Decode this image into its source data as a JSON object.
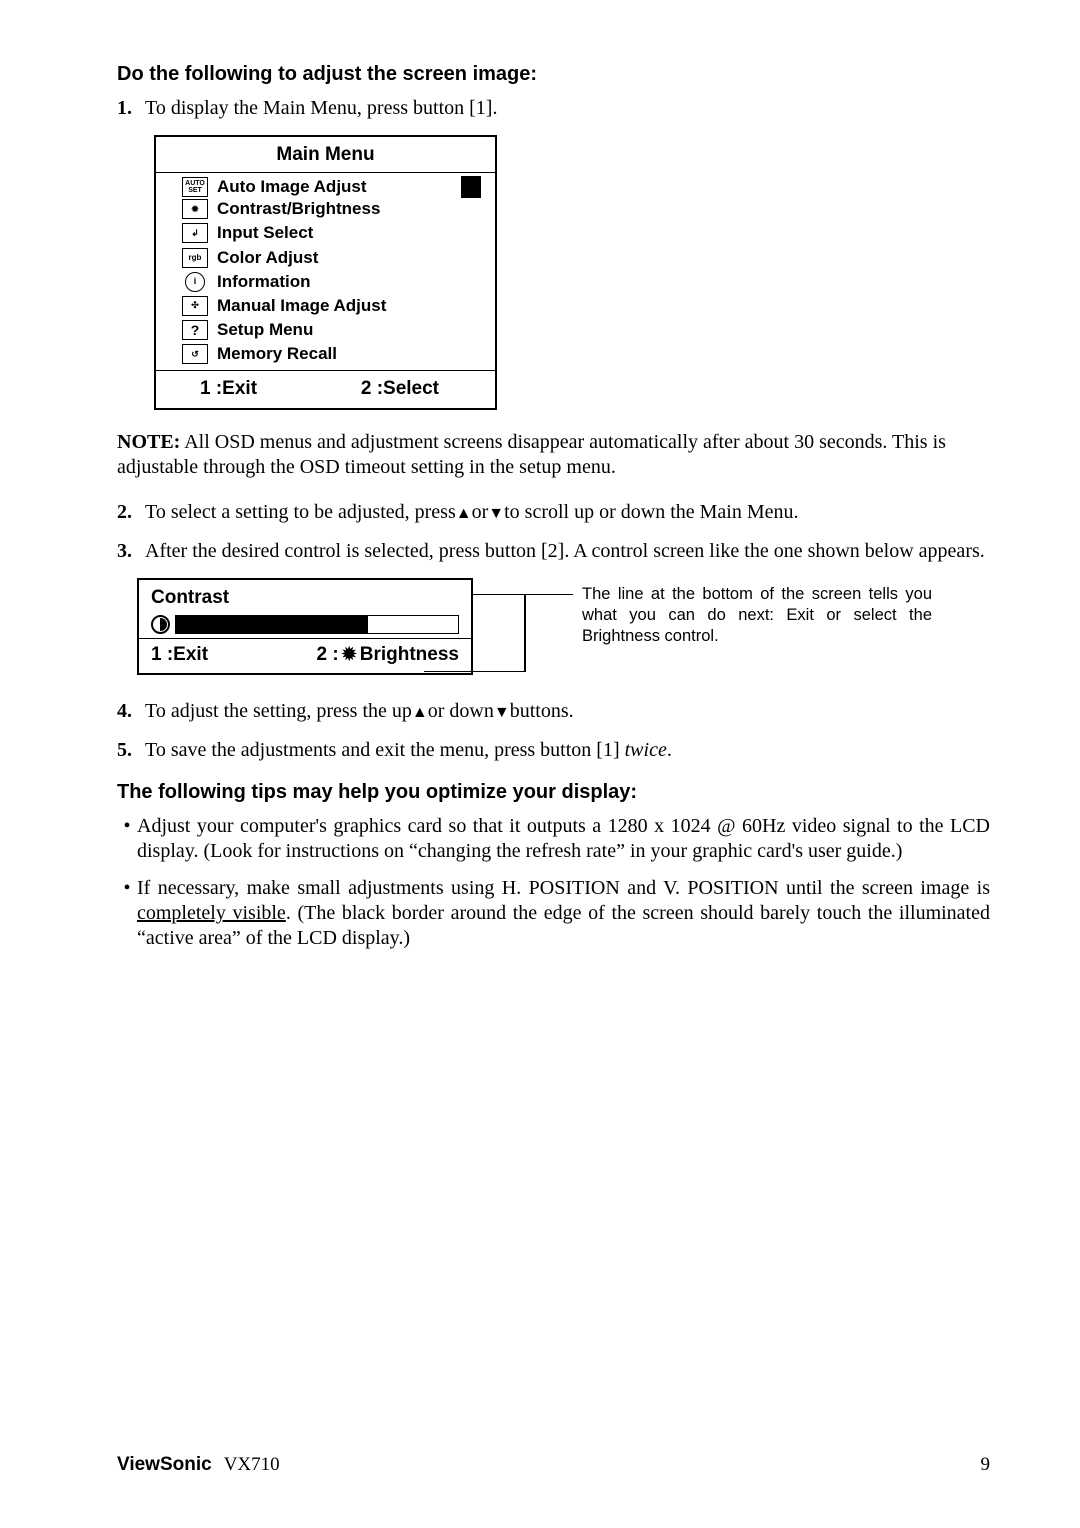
{
  "h_adjust": "Do the following to adjust the screen image:",
  "step1_num": "1.",
  "step1_text": "To display the Main Menu, press button [1].",
  "menu_title": "Main Menu",
  "menu_items": [
    {
      "label": "Auto Image Adjust",
      "icon_text": "AUTO SET",
      "highlight": true
    },
    {
      "label": "Contrast/Brightness",
      "icon_text": "✹"
    },
    {
      "label": "Input Select",
      "icon_text": "↲"
    },
    {
      "label": "Color Adjust",
      "icon_text": "rgb"
    },
    {
      "label": "Information",
      "icon_text": "i"
    },
    {
      "label": "Manual Image Adjust",
      "icon_text": "✣"
    },
    {
      "label": "Setup Menu",
      "icon_text": "?"
    },
    {
      "label": "Memory Recall",
      "icon_text": "↺"
    }
  ],
  "menu_footer_left": "1 :Exit",
  "menu_footer_right": "2 :Select",
  "note_label": "NOTE:",
  "note_text": " All OSD menus and adjustment screens disappear automatically after about 30 seconds. This is adjustable through the OSD timeout setting in the setup menu.",
  "step2_num": "2.",
  "step2_a": "To select a setting to be adjusted, press",
  "step2_b": "or",
  "step2_c": "to scroll up or down the Main Menu.",
  "step3_num": "3.",
  "step3_text": "After the desired control is selected, press button [2]. A control screen like the one shown below appears.",
  "contrast_title": "Contrast",
  "contrast_left": "1 :Exit",
  "contrast_right_a": "2 :",
  "contrast_right_b": " Brightness",
  "callout_text": "The line at the bottom of the screen tells you what you can do next: Exit or select the Brightness control.",
  "step4_num": "4.",
  "step4_a": "To adjust the setting, press the up",
  "step4_b": "or down",
  "step4_c": "buttons.",
  "step5_num": "5.",
  "step5_a": "To save the adjustments and exit the menu, press button [1] ",
  "step5_twice": "twice",
  "step5_dot": ".",
  "h_tips": "The following tips may help you optimize your display:",
  "tip1": "Adjust your computer's graphics card so that it outputs a 1280 x 1024 @ 60Hz video signal to the LCD display. (Look for instructions on “changing the refresh rate” in your graphic card's user guide.)",
  "tip2_a": "If necessary, make small adjustments using H. POSITION and V. POSITION until the screen image is ",
  "tip2_u": "completely visible",
  "tip2_b": ". (The black border around the edge of the screen should barely touch the illuminated “active area” of the LCD display.)",
  "footer_brand": "ViewSonic",
  "footer_model": "VX710",
  "footer_page": "9"
}
